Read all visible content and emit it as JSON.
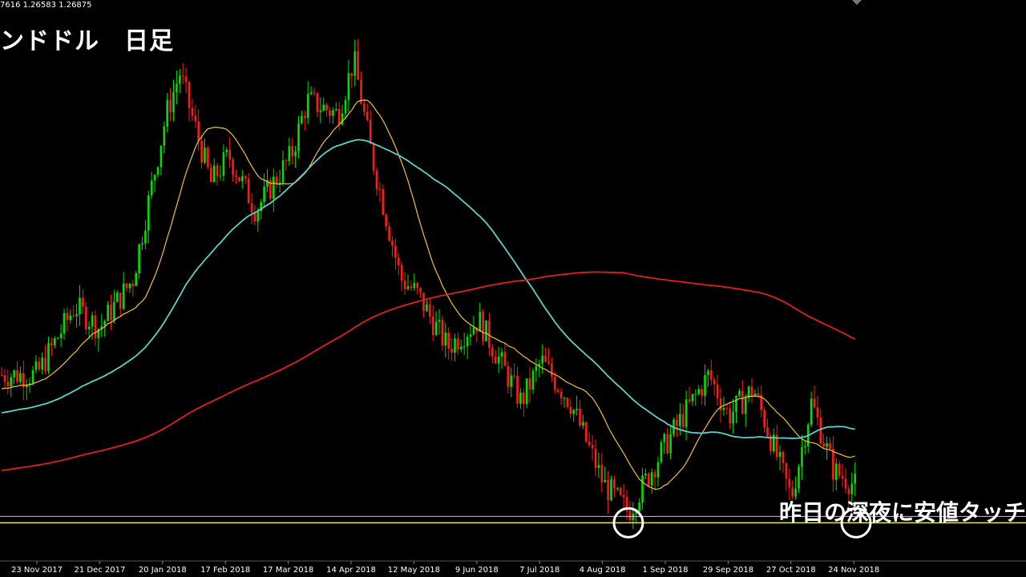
{
  "header": {
    "ohlc_text": "7616 1.26583 1.26875",
    "title": "ンドドル　日足"
  },
  "annotation": {
    "text": "昨日の深夜に安値タッチ"
  },
  "colors": {
    "background": "#000000",
    "bull_candle": "#00e000",
    "bear_candle": "#ff1a1a",
    "ma_short": "#f0c040",
    "ma_mid": "#5fd0c8",
    "ma_long": "#e02020",
    "support_line": "#f0e060",
    "marker_circle": "#ffffff"
  },
  "chart_data": {
    "type": "candlestick",
    "title": "",
    "x_ticks": [
      "23 Nov 2017",
      "21 Dec 2017",
      "20 Jan 2018",
      "17 Feb 2018",
      "17 Mar 2018",
      "14 Apr 2018",
      "12 May 2018",
      "9 Jun 2018",
      "7 Jul 2018",
      "4 Aug 2018",
      "1 Sep 2018",
      "29 Sep 2018",
      "27 Oct 2018",
      "24 Nov 2018"
    ],
    "close_trend": [
      [
        "23 Nov 2017",
        1.32
      ],
      [
        "10 Dec 2017",
        1.345
      ],
      [
        "21 Dec 2017",
        1.337
      ],
      [
        "5 Jan 2018",
        1.355
      ],
      [
        "20 Jan 2018",
        1.415
      ],
      [
        "26 Jan 2018",
        1.43
      ],
      [
        "9 Feb 2018",
        1.39
      ],
      [
        "17 Feb 2018",
        1.4
      ],
      [
        "1 Mar 2018",
        1.38
      ],
      [
        "17 Mar 2018",
        1.4
      ],
      [
        "24 Mar 2018",
        1.42
      ],
      [
        "7 Apr 2018",
        1.415
      ],
      [
        "14 Apr 2018",
        1.435
      ],
      [
        "22 Apr 2018",
        1.4
      ],
      [
        "5 May 2018",
        1.355
      ],
      [
        "12 May 2018",
        1.35
      ],
      [
        "26 May 2018",
        1.33
      ],
      [
        "9 Jun 2018",
        1.34
      ],
      [
        "28 Jun 2018",
        1.31
      ],
      [
        "7 Jul 2018",
        1.325
      ],
      [
        "20 Jul 2018",
        1.31
      ],
      [
        "4 Aug 2018",
        1.28
      ],
      [
        "15 Aug 2018",
        1.27
      ],
      [
        "1 Sep 2018",
        1.295
      ],
      [
        "20 Sep 2018",
        1.32
      ],
      [
        "29 Sep 2018",
        1.305
      ],
      [
        "10 Oct 2018",
        1.315
      ],
      [
        "27 Oct 2018",
        1.275
      ],
      [
        "5 Nov 2018",
        1.31
      ],
      [
        "15 Nov 2018",
        1.285
      ],
      [
        "24 Nov 2018",
        1.28
      ],
      [
        "5 Dec 2018",
        1.27
      ]
    ],
    "moving_averages": [
      {
        "key": "short",
        "color": "#f0c040"
      },
      {
        "key": "mid",
        "color": "#5fd0c8"
      },
      {
        "key": "long",
        "color": "#e02020"
      }
    ],
    "support_level": 1.266,
    "touch_points": [
      "15 Aug 2018",
      "5 Dec 2018"
    ],
    "ylim": [
      1.255,
      1.445
    ],
    "grid": false,
    "legend": "none"
  }
}
